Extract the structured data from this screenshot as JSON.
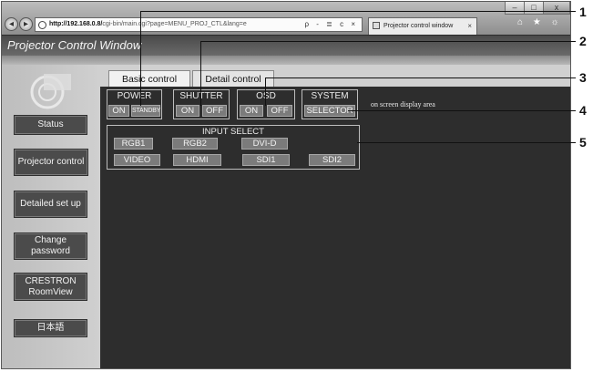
{
  "browser": {
    "address_host": "http://192.168.0.8/",
    "address_path": "cgi-bin/main.cgi?page=MENU_PROJ_CTL&lang=e",
    "address_tools": "ρ - ≣ c ×",
    "tab_title": "Projector control window",
    "tab_close": "×",
    "window_buttons": {
      "minimize": "–",
      "maximize": "□",
      "close": "x"
    },
    "top_icons": "⌂ ★ ☼"
  },
  "app": {
    "title": "Projector Control Window"
  },
  "sidebar": {
    "items": [
      {
        "label": "Status"
      },
      {
        "label": "Projector control"
      },
      {
        "label": "Detailed set up"
      },
      {
        "label": "Change password"
      },
      {
        "label": "CRESTRON RoomView"
      },
      {
        "label": "日本語"
      }
    ]
  },
  "tabs": {
    "basic": "Basic control",
    "detail": "Detail control"
  },
  "controls": {
    "power": {
      "label": "POWER",
      "on": "ON",
      "standby": "STANDBY"
    },
    "shutter": {
      "label": "SHUTTER",
      "on": "ON",
      "off": "OFF"
    },
    "osd": {
      "label": "OSD",
      "on": "ON",
      "off": "OFF"
    },
    "system": {
      "label": "SYSTEM",
      "selector": "SELECTOR"
    },
    "osd_note": "on screen display area"
  },
  "input_select": {
    "title": "INPUT SELECT",
    "row1": [
      "RGB1",
      "RGB2",
      "DVI-D"
    ],
    "row2": [
      "VIDEO",
      "HDMI",
      "SDI1",
      "SDI2"
    ]
  },
  "callouts": [
    "1",
    "2",
    "3",
    "4",
    "5"
  ]
}
